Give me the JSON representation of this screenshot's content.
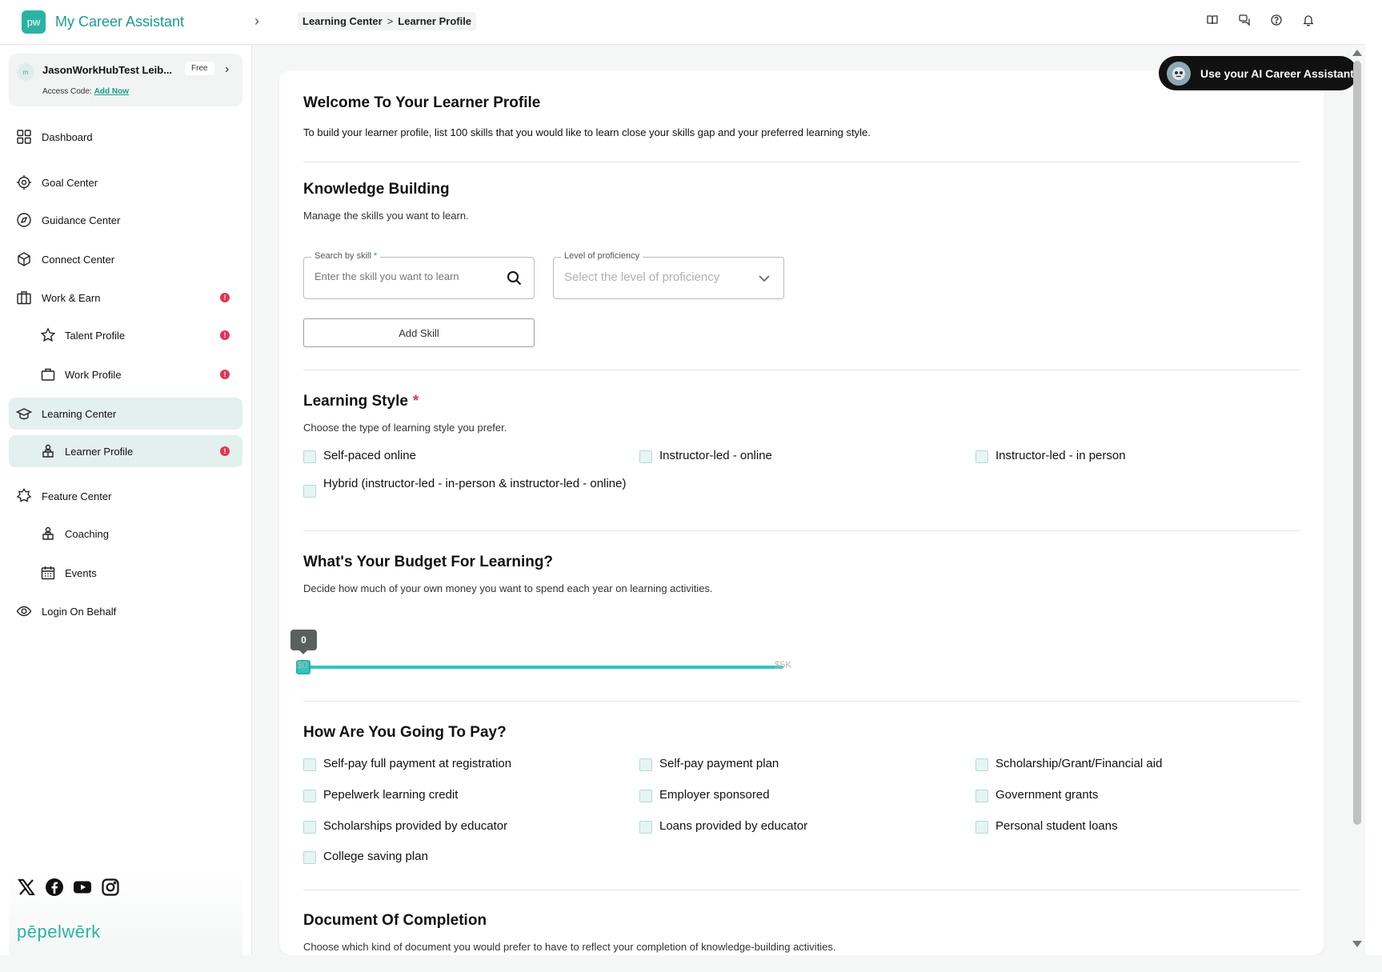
{
  "header": {
    "logo_text": "pw",
    "app_title": "My Career Assistant",
    "collapse_icon": "chevron-right-icon",
    "breadcrumb": [
      "Learning Center",
      "Learner Profile"
    ],
    "breadcrumb_sep": ">",
    "icons": [
      "book-icon",
      "chat-icon",
      "help-icon",
      "bell-icon"
    ]
  },
  "user": {
    "avatar_text": "m",
    "name": "JasonWorkHubTest Leib...",
    "plan": "Free",
    "access_label": "Access Code:",
    "access_link": "Add Now"
  },
  "sidebar": {
    "items": [
      {
        "label": "Dashboard",
        "icon": "grid-icon"
      },
      {
        "label": "Goal Center",
        "icon": "target-icon"
      },
      {
        "label": "Guidance Center",
        "icon": "compass-icon"
      },
      {
        "label": "Connect Center",
        "icon": "cube-icon"
      },
      {
        "label": "Work & Earn",
        "icon": "briefcase-icon",
        "badge": "!"
      },
      {
        "label": "Talent Profile",
        "icon": "star-icon",
        "badge": "!"
      },
      {
        "label": "Work Profile",
        "icon": "bag-icon",
        "badge": "!"
      },
      {
        "label": "Learning Center",
        "icon": "graduation-cap-icon"
      },
      {
        "label": "Learner Profile",
        "icon": "learner-icon",
        "badge": "!"
      },
      {
        "label": "Feature Center",
        "icon": "badge-star-icon"
      },
      {
        "label": "Coaching",
        "icon": "coaching-icon"
      },
      {
        "label": "Events",
        "icon": "calendar-icon"
      },
      {
        "label": "Login On Behalf",
        "icon": "eye-icon"
      }
    ],
    "social": [
      "x-icon",
      "facebook-icon",
      "youtube-icon",
      "instagram-icon"
    ],
    "brand": "pēpelwērk"
  },
  "ai_button": {
    "label": "Use your AI Career Assistant"
  },
  "welcome": {
    "title": "Welcome To Your Learner Profile",
    "desc": "To build your learner profile, list 100 skills that you would like to learn close your skills gap and your preferred learning style."
  },
  "knowledge": {
    "title": "Knowledge Building",
    "desc": "Manage the skills you want to learn.",
    "search_label": "Search by skill",
    "search_required": "*",
    "search_placeholder": "Enter the skill you want to learn",
    "level_label": "Level of proficiency",
    "level_placeholder": "Select the level of proficiency",
    "add_button": "Add Skill"
  },
  "learning_style": {
    "title": "Learning Style",
    "required": "*",
    "desc": "Choose the type of learning style you prefer.",
    "options": [
      "Self-paced online",
      "Instructor-led - online",
      "Instructor-led - in person",
      "Hybrid (instructor-led - in-person & instructor-led - online)"
    ]
  },
  "budget": {
    "title": "What's Your Budget For Learning?",
    "desc": "Decide how much of your own money you want to spend each year on learning activities.",
    "value": "0",
    "fraction": 0,
    "min_label": "$0",
    "max_label": "$5K"
  },
  "payment": {
    "title": "How Are You Going To Pay?",
    "options": [
      "Self-pay full payment at registration",
      "Self-pay payment plan",
      "Scholarship/Grant/Financial aid",
      "Pepelwerk learning credit",
      "Employer sponsored",
      "Government grants",
      "Scholarships provided by educator",
      "Loans provided by educator",
      "Personal student loans",
      "College saving plan"
    ]
  },
  "completion": {
    "title": "Document Of Completion",
    "desc": "Choose which kind of document you would prefer to have to reflect your completion of knowledge-building activities."
  },
  "colors": {
    "accent": "#2bb3a3",
    "badge": "#e53353",
    "active_bg": "#e3f1ee"
  }
}
